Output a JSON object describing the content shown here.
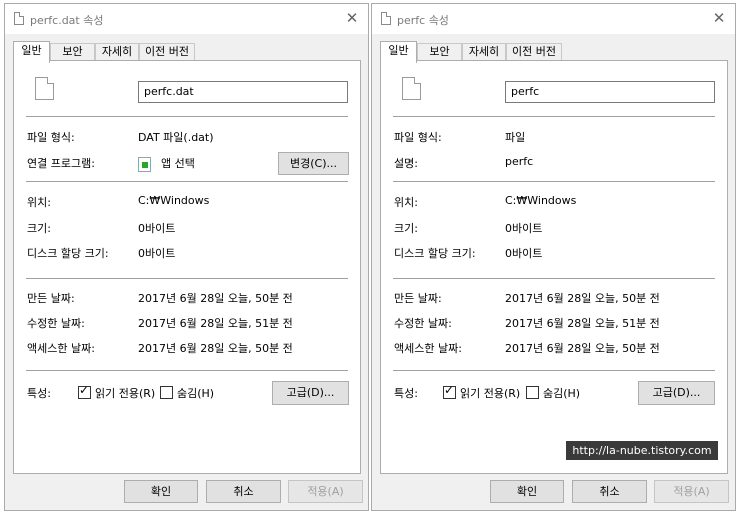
{
  "left": {
    "window_title": "perfc.dat 속성",
    "tabs": [
      "일반",
      "보안",
      "자세히",
      "이전 버전"
    ],
    "file_name": "perfc.dat",
    "file_type_label": "파일 형식:",
    "file_type_value": "DAT 파일(.dat)",
    "second_label": "연결 프로그램:",
    "second_value": "앱 선택",
    "change_button": "변경(C)...",
    "location_label": "위치:",
    "location_value": "C:₩Windows",
    "size_label": "크기:",
    "size_value": "0바이트",
    "disk_label": "디스크 할당 크기:",
    "disk_value": "0바이트",
    "created_label": "만든 날짜:",
    "created_value": "2017년 6월 28일 오늘, 50분 전",
    "modified_label": "수정한 날짜:",
    "modified_value": "2017년 6월 28일 오늘, 51분 전",
    "accessed_label": "액세스한 날짜:",
    "accessed_value": "2017년 6월 28일 오늘, 50분 전",
    "attributes_label": "특성:",
    "readonly_label": "읽기 전용(R)",
    "hidden_label": "숨김(H)",
    "advanced_button": "고급(D)...",
    "ok_button": "확인",
    "cancel_button": "취소",
    "apply_button": "적용(A)"
  },
  "right": {
    "window_title": "perfc 속성",
    "tabs": [
      "일반",
      "보안",
      "자세히",
      "이전 버전"
    ],
    "file_name": "perfc",
    "file_type_label": "파일 형식:",
    "file_type_value": "파일",
    "second_label": "설명:",
    "second_value": "perfc",
    "location_label": "위치:",
    "location_value": "C:₩Windows",
    "size_label": "크기:",
    "size_value": "0바이트",
    "disk_label": "디스크 할당 크기:",
    "disk_value": "0바이트",
    "created_label": "만든 날짜:",
    "created_value": "2017년 6월 28일 오늘, 50분 전",
    "modified_label": "수정한 날짜:",
    "modified_value": "2017년 6월 28일 오늘, 51분 전",
    "accessed_label": "액세스한 날짜:",
    "accessed_value": "2017년 6월 28일 오늘, 50분 전",
    "attributes_label": "특성:",
    "readonly_label": "읽기 전용(R)",
    "hidden_label": "숨김(H)",
    "advanced_button": "고급(D)...",
    "ok_button": "확인",
    "cancel_button": "취소",
    "apply_button": "적용(A)"
  },
  "watermark": "http://la-nube.tistory.com",
  "icons": {
    "title_icon": "document-icon",
    "file_icon": "blank-file-icon",
    "app_icon": "open-with-app-icon",
    "close_icon": "close-icon"
  },
  "colors": {
    "dialog_bg": "#f0f0f0",
    "panel_bg": "#ffffff",
    "button_bg": "#e1e1e1",
    "disabled_text": "#a0a0a0",
    "watermark_bg": "#3a3a3a"
  }
}
